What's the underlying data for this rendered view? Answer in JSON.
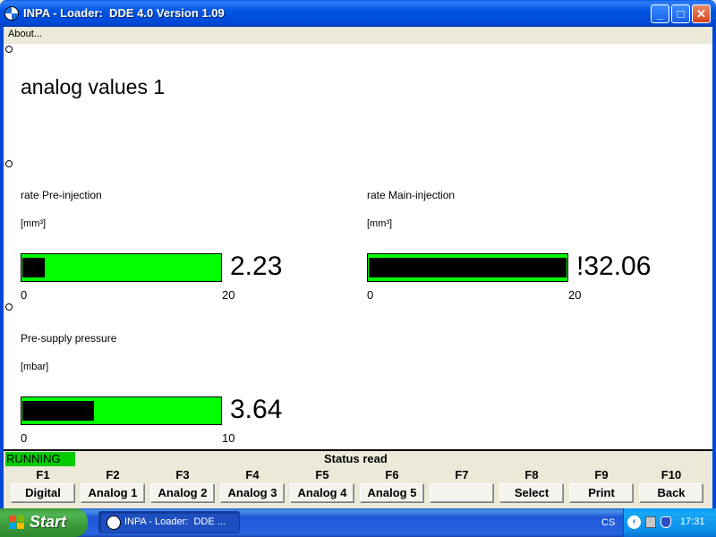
{
  "window": {
    "title": "INPA - Loader:  DDE 4.0 Version 1.09",
    "controls": {
      "minimize": "_",
      "maximize": "□",
      "close": "✕"
    }
  },
  "menu": {
    "about": "About..."
  },
  "main": {
    "heading": "analog values 1",
    "gauges": [
      {
        "label": "rate Pre-injection",
        "unit": "[mm³]",
        "value_text": "2.23",
        "min": "0",
        "max": "20",
        "level": 0.112
      },
      {
        "label": "rate Main-injection",
        "unit": "[mm³]",
        "value_text": "!32.06",
        "min": "0",
        "max": "20",
        "level": 1.0
      },
      {
        "label": "Pre-supply pressure",
        "unit": "[mbar]",
        "value_text": "3.64",
        "min": "0",
        "max": "10",
        "level": 0.364
      }
    ]
  },
  "status": {
    "state": "RUNNING",
    "message": "Status read"
  },
  "function_keys": [
    {
      "key": "F1",
      "label": "Digital"
    },
    {
      "key": "F2",
      "label": "Analog 1"
    },
    {
      "key": "F3",
      "label": "Analog 2"
    },
    {
      "key": "F4",
      "label": "Analog 3"
    },
    {
      "key": "F5",
      "label": "Analog 4"
    },
    {
      "key": "F6",
      "label": "Analog 5"
    },
    {
      "key": "F7",
      "label": ""
    },
    {
      "key": "F8",
      "label": "Select"
    },
    {
      "key": "F9",
      "label": "Print"
    },
    {
      "key": "F10",
      "label": "Back"
    }
  ],
  "taskbar": {
    "start": "Start",
    "task": "INPA - Loader:  DDE ...",
    "language": "CS",
    "clock": "17:31",
    "icons": [
      "bmw-icon",
      "chevron-left-icon",
      "network-icon",
      "shield-icon"
    ]
  },
  "colors": {
    "bar_green": "#00ff00",
    "running_green": "#00cc00",
    "xp_blue": "#0055e5"
  }
}
